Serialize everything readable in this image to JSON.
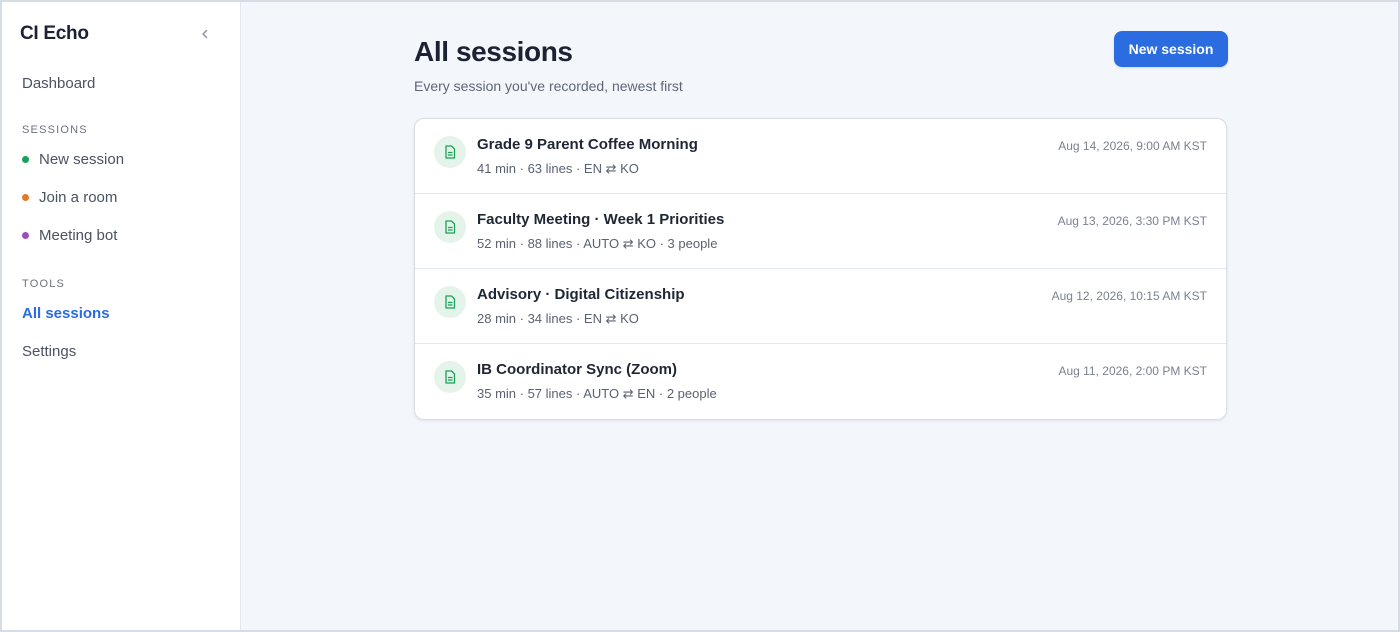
{
  "sidebar": {
    "brand": "CI Echo",
    "dashboard_label": "Dashboard",
    "sessions_heading": "SESSIONS",
    "sessions_items": [
      {
        "label": "New session",
        "dot_color": "#1aa156"
      },
      {
        "label": "Join a room",
        "dot_color": "#e07b2b"
      },
      {
        "label": "Meeting bot",
        "dot_color": "#9b4fb3"
      }
    ],
    "tools_heading": "TOOLS",
    "tools_items": [
      {
        "label": "All sessions"
      },
      {
        "label": "Settings"
      }
    ]
  },
  "header": {
    "title": "All sessions",
    "subtitle": "Every session you've recorded, newest first",
    "new_session_label": "New session"
  },
  "sessions": [
    {
      "title": "Grade 9 Parent Coffee Morning",
      "meta": "41 min · 63 lines · EN ⇄ KO",
      "date": "Aug 14, 2026, 9:00 AM KST"
    },
    {
      "title": "Faculty Meeting · Week 1 Priorities",
      "meta": "52 min · 88 lines · AUTO ⇄ KO · 3 people",
      "date": "Aug 13, 2026, 3:30 PM KST"
    },
    {
      "title": "Advisory · Digital Citizenship",
      "meta": "28 min · 34 lines · EN ⇄ KO",
      "date": "Aug 12, 2026, 10:15 AM KST"
    },
    {
      "title": "IB Coordinator Sync (Zoom)",
      "meta": "35 min · 57 lines · AUTO ⇄ EN · 2 people",
      "date": "Aug 11, 2026, 2:00 PM KST"
    }
  ],
  "colors": {
    "accent": "#2b6de0",
    "session_icon": "#1aa156"
  },
  "icons": {
    "collapse": "chevron-left-icon",
    "session": "document-icon"
  }
}
